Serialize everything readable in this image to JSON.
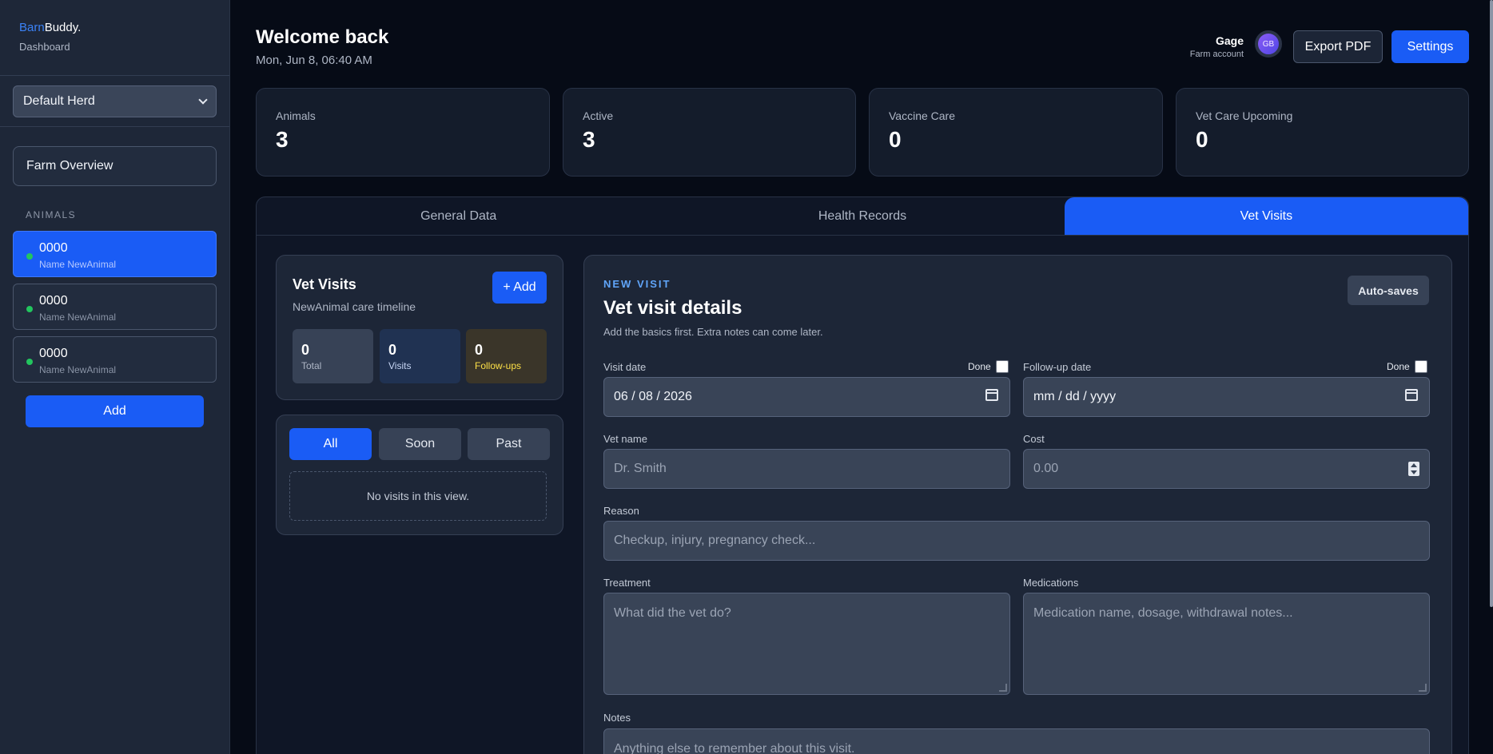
{
  "brand": {
    "part1": "Barn",
    "part2": "Buddy.",
    "subtitle": "Dashboard"
  },
  "herd": {
    "selected": "Default Herd"
  },
  "sidebar": {
    "overview_label": "Farm Overview",
    "section_label": "ANIMALS",
    "animals": [
      {
        "id": "0000",
        "name": "Name NewAnimal",
        "status_color": "#22c55e"
      },
      {
        "id": "0000",
        "name": "Name NewAnimal",
        "status_color": "#22c55e"
      },
      {
        "id": "0000",
        "name": "Name NewAnimal",
        "status_color": "#22c55e"
      }
    ],
    "add_label": "Add"
  },
  "header": {
    "welcome": "Welcome back",
    "date": "Mon, Jun 8, 06:40 AM",
    "user_name": "Gage",
    "user_role": "Farm account",
    "avatar_initials": "GB",
    "export_label": "Export PDF",
    "settings_label": "Settings"
  },
  "stats": [
    {
      "label": "Animals",
      "value": "3"
    },
    {
      "label": "Active",
      "value": "3"
    },
    {
      "label": "Vaccine Care",
      "value": "0"
    },
    {
      "label": "Vet Care Upcoming",
      "value": "0"
    }
  ],
  "tabs": [
    {
      "label": "General Data"
    },
    {
      "label": "Health Records"
    },
    {
      "label": "Vet Visits"
    }
  ],
  "visits_card": {
    "title": "Vet Visits",
    "subtitle": "NewAnimal care timeline",
    "add_label": "+ Add",
    "counters": [
      {
        "value": "0",
        "label": "Total"
      },
      {
        "value": "0",
        "label": "Visits"
      },
      {
        "value": "0",
        "label": "Follow-ups"
      }
    ]
  },
  "filters": {
    "options": [
      "All",
      "Soon",
      "Past"
    ],
    "empty_text": "No visits in this view."
  },
  "form": {
    "kicker": "NEW VISIT",
    "title": "Vet visit details",
    "subtitle": "Add the basics first. Extra notes can come later.",
    "autosave_label": "Auto-saves",
    "visit_date_label": "Visit date",
    "visit_date_value": "06 / 08 / 2026",
    "followup_label": "Follow-up date",
    "followup_placeholder": "mm / dd / yyyy",
    "done_label": "Done",
    "vet_name_label": "Vet name",
    "vet_name_placeholder": "Dr. Smith",
    "cost_label": "Cost",
    "cost_placeholder": "0.00",
    "reason_label": "Reason",
    "reason_placeholder": "Checkup, injury, pregnancy check...",
    "treatment_label": "Treatment",
    "treatment_placeholder": "What did the vet do?",
    "medications_label": "Medications",
    "medications_placeholder": "Medication name, dosage, withdrawal notes...",
    "notes_label": "Notes",
    "notes_placeholder": "Anything else to remember about this visit."
  },
  "colors": {
    "accent": "#1a5cf5",
    "background": "#060b16",
    "sidebar": "#1e2738",
    "status_active": "#22c55e",
    "followups_text": "#fde047"
  }
}
